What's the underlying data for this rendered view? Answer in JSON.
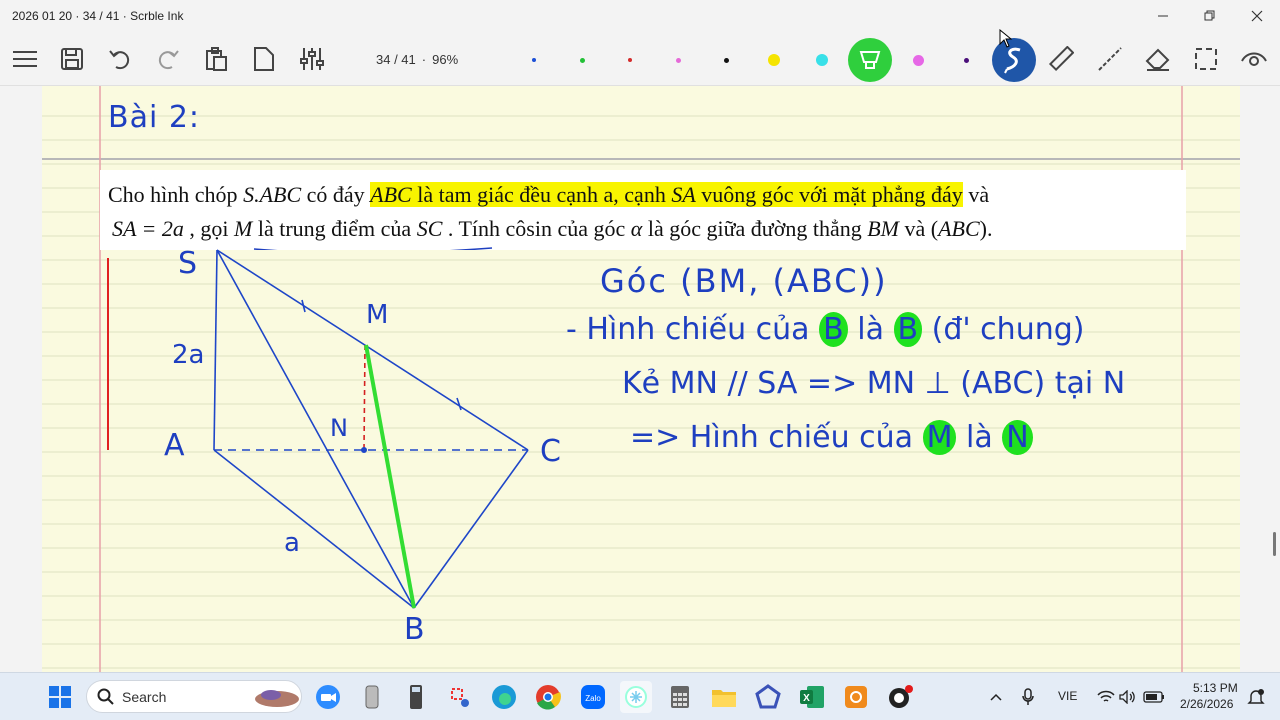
{
  "window": {
    "title": "2026 01 20 · 34 / 41 · Scrble Ink"
  },
  "toolbar": {
    "page": "34 / 41",
    "zoom": "96%",
    "pen_colors": [
      "#1b4fd6",
      "#22c036",
      "#d42b2b",
      "#e56ad8",
      "#111111",
      "#f5e400",
      "#38e0e8",
      "#27cf3a",
      "#e667e6",
      "#4b0f7a"
    ],
    "active_highlighter_color": "#27cf3a",
    "active_tool_color": "#1f56a8"
  },
  "note": {
    "heading": "Bài 2:",
    "problem_line1_parts": [
      "Cho hình chóp ",
      "S.ABC",
      " có đáy ",
      "ABC",
      " là tam giác đều cạnh a, cạnh ",
      "SA",
      " vuông góc với mặt phẳng đáy",
      " và"
    ],
    "problem_line2_parts": [
      "SA = 2a",
      " , gọi ",
      "M",
      " là trung điểm của ",
      "SC",
      " . Tính côsin của góc ",
      "α",
      " là góc giữa đường thẳng ",
      "BM",
      " và (",
      "ABC",
      ")."
    ],
    "figure_labels": {
      "S": "S",
      "A": "A",
      "B": "B",
      "C": "C",
      "M": "M",
      "N": "N",
      "SA_len": "2a",
      "AB_len": "a"
    },
    "work": {
      "line1": "Góc (BM, (ABC))",
      "line2_prefix": "- Hình chiếu của",
      "line2_b1": "B",
      "line2_mid": "là",
      "line2_b2": "B",
      "line2_suffix": "(đ' chung)",
      "line3": "Kẻ MN // SA => MN ⊥ (ABC) tại N",
      "line4_prefix": "=> Hình chiếu của",
      "line4_m": "M",
      "line4_mid": "là",
      "line4_n": "N"
    }
  },
  "taskbar": {
    "search_label": "Search",
    "lang": "VIE",
    "time": "5:13 PM",
    "date": "2/26/2026"
  }
}
